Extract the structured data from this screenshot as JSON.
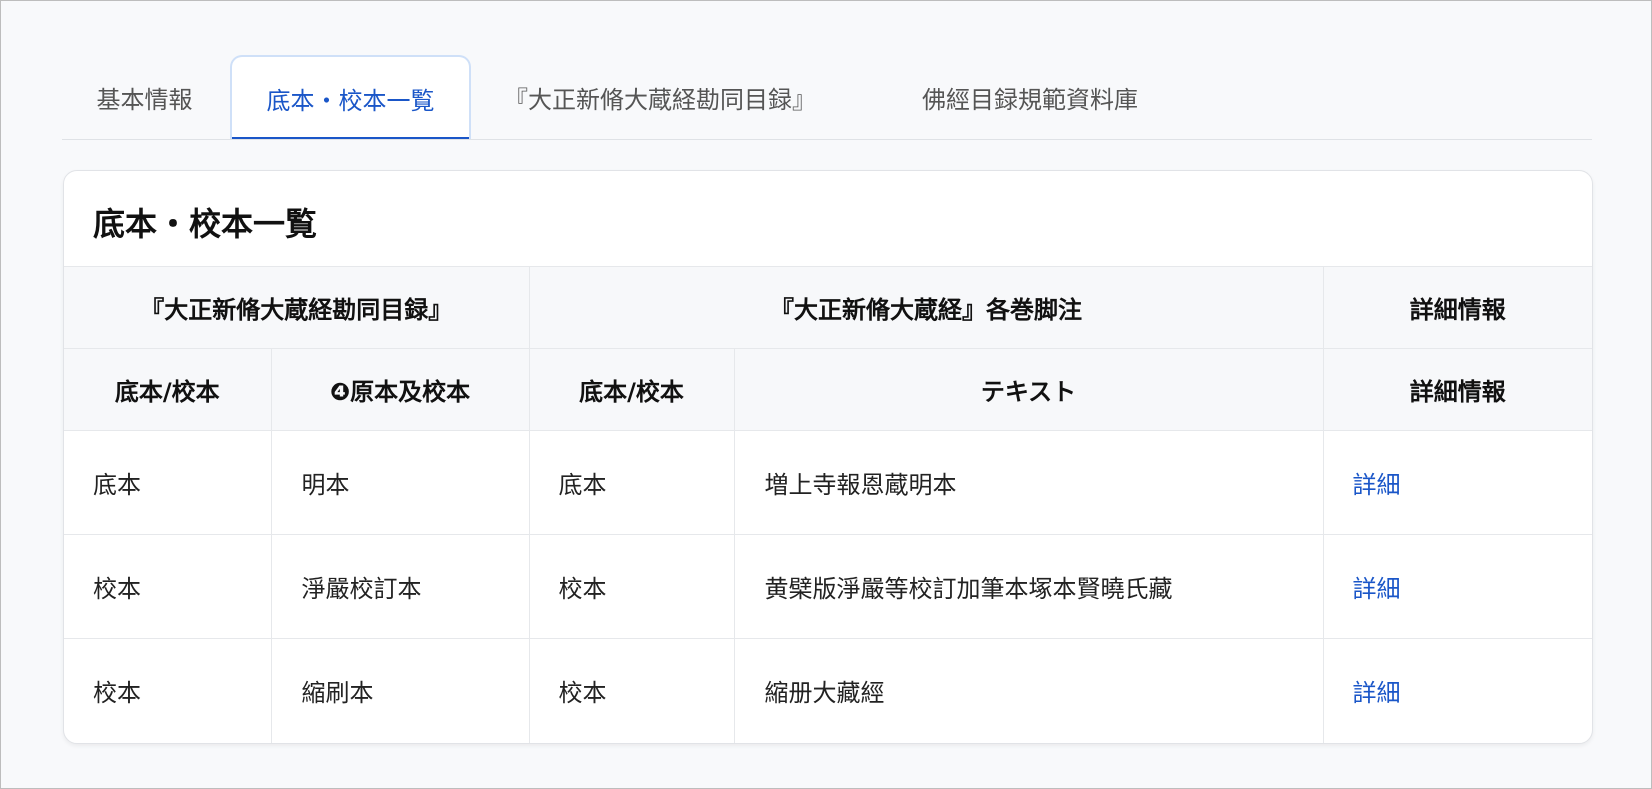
{
  "tabs": [
    {
      "label": "基本情報"
    },
    {
      "label": "底本・校本一覧"
    },
    {
      "label": "『大正新脩大蔵経勘同目録』"
    },
    {
      "label": "佛經目録規範資料庫"
    }
  ],
  "card": {
    "title": "底本・校本一覧",
    "group_headers": {
      "mokuroku": "『大正新脩大蔵経勘同目録』",
      "kyakuchu": "『大正新脩大蔵経』各巻脚注",
      "detail": "詳細情報"
    },
    "sub_headers": {
      "col1": "底本/校本",
      "col2": "❹原本及校本",
      "col3": "底本/校本",
      "col4": "テキスト",
      "col5": "詳細情報"
    },
    "rows": [
      {
        "c1": "底本",
        "c2": "明本",
        "c3": "底本",
        "c4": "増上寺報恩蔵明本",
        "link": "詳細"
      },
      {
        "c1": "校本",
        "c2": "淨嚴校訂本",
        "c3": "校本",
        "c4": "黄檗版淨嚴等校訂加筆本塚本賢曉氏藏",
        "link": "詳細"
      },
      {
        "c1": "校本",
        "c2": "縮刷本",
        "c3": "校本",
        "c4": "縮册大藏經",
        "link": "詳細"
      }
    ]
  }
}
